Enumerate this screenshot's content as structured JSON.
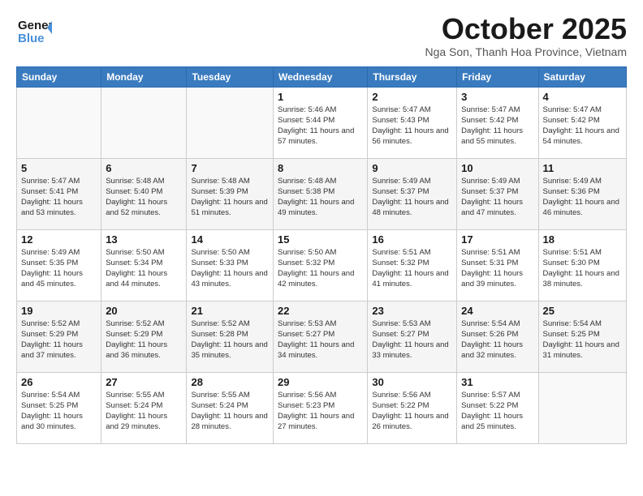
{
  "header": {
    "logo_line1": "General",
    "logo_line2": "Blue",
    "month": "October 2025",
    "location": "Nga Son, Thanh Hoa Province, Vietnam"
  },
  "weekdays": [
    "Sunday",
    "Monday",
    "Tuesday",
    "Wednesday",
    "Thursday",
    "Friday",
    "Saturday"
  ],
  "weeks": [
    [
      {
        "day": "",
        "info": ""
      },
      {
        "day": "",
        "info": ""
      },
      {
        "day": "",
        "info": ""
      },
      {
        "day": "1",
        "info": "Sunrise: 5:46 AM\nSunset: 5:44 PM\nDaylight: 11 hours and 57 minutes."
      },
      {
        "day": "2",
        "info": "Sunrise: 5:47 AM\nSunset: 5:43 PM\nDaylight: 11 hours and 56 minutes."
      },
      {
        "day": "3",
        "info": "Sunrise: 5:47 AM\nSunset: 5:42 PM\nDaylight: 11 hours and 55 minutes."
      },
      {
        "day": "4",
        "info": "Sunrise: 5:47 AM\nSunset: 5:42 PM\nDaylight: 11 hours and 54 minutes."
      }
    ],
    [
      {
        "day": "5",
        "info": "Sunrise: 5:47 AM\nSunset: 5:41 PM\nDaylight: 11 hours and 53 minutes."
      },
      {
        "day": "6",
        "info": "Sunrise: 5:48 AM\nSunset: 5:40 PM\nDaylight: 11 hours and 52 minutes."
      },
      {
        "day": "7",
        "info": "Sunrise: 5:48 AM\nSunset: 5:39 PM\nDaylight: 11 hours and 51 minutes."
      },
      {
        "day": "8",
        "info": "Sunrise: 5:48 AM\nSunset: 5:38 PM\nDaylight: 11 hours and 49 minutes."
      },
      {
        "day": "9",
        "info": "Sunrise: 5:49 AM\nSunset: 5:37 PM\nDaylight: 11 hours and 48 minutes."
      },
      {
        "day": "10",
        "info": "Sunrise: 5:49 AM\nSunset: 5:37 PM\nDaylight: 11 hours and 47 minutes."
      },
      {
        "day": "11",
        "info": "Sunrise: 5:49 AM\nSunset: 5:36 PM\nDaylight: 11 hours and 46 minutes."
      }
    ],
    [
      {
        "day": "12",
        "info": "Sunrise: 5:49 AM\nSunset: 5:35 PM\nDaylight: 11 hours and 45 minutes."
      },
      {
        "day": "13",
        "info": "Sunrise: 5:50 AM\nSunset: 5:34 PM\nDaylight: 11 hours and 44 minutes."
      },
      {
        "day": "14",
        "info": "Sunrise: 5:50 AM\nSunset: 5:33 PM\nDaylight: 11 hours and 43 minutes."
      },
      {
        "day": "15",
        "info": "Sunrise: 5:50 AM\nSunset: 5:32 PM\nDaylight: 11 hours and 42 minutes."
      },
      {
        "day": "16",
        "info": "Sunrise: 5:51 AM\nSunset: 5:32 PM\nDaylight: 11 hours and 41 minutes."
      },
      {
        "day": "17",
        "info": "Sunrise: 5:51 AM\nSunset: 5:31 PM\nDaylight: 11 hours and 39 minutes."
      },
      {
        "day": "18",
        "info": "Sunrise: 5:51 AM\nSunset: 5:30 PM\nDaylight: 11 hours and 38 minutes."
      }
    ],
    [
      {
        "day": "19",
        "info": "Sunrise: 5:52 AM\nSunset: 5:29 PM\nDaylight: 11 hours and 37 minutes."
      },
      {
        "day": "20",
        "info": "Sunrise: 5:52 AM\nSunset: 5:29 PM\nDaylight: 11 hours and 36 minutes."
      },
      {
        "day": "21",
        "info": "Sunrise: 5:52 AM\nSunset: 5:28 PM\nDaylight: 11 hours and 35 minutes."
      },
      {
        "day": "22",
        "info": "Sunrise: 5:53 AM\nSunset: 5:27 PM\nDaylight: 11 hours and 34 minutes."
      },
      {
        "day": "23",
        "info": "Sunrise: 5:53 AM\nSunset: 5:27 PM\nDaylight: 11 hours and 33 minutes."
      },
      {
        "day": "24",
        "info": "Sunrise: 5:54 AM\nSunset: 5:26 PM\nDaylight: 11 hours and 32 minutes."
      },
      {
        "day": "25",
        "info": "Sunrise: 5:54 AM\nSunset: 5:25 PM\nDaylight: 11 hours and 31 minutes."
      }
    ],
    [
      {
        "day": "26",
        "info": "Sunrise: 5:54 AM\nSunset: 5:25 PM\nDaylight: 11 hours and 30 minutes."
      },
      {
        "day": "27",
        "info": "Sunrise: 5:55 AM\nSunset: 5:24 PM\nDaylight: 11 hours and 29 minutes."
      },
      {
        "day": "28",
        "info": "Sunrise: 5:55 AM\nSunset: 5:24 PM\nDaylight: 11 hours and 28 minutes."
      },
      {
        "day": "29",
        "info": "Sunrise: 5:56 AM\nSunset: 5:23 PM\nDaylight: 11 hours and 27 minutes."
      },
      {
        "day": "30",
        "info": "Sunrise: 5:56 AM\nSunset: 5:22 PM\nDaylight: 11 hours and 26 minutes."
      },
      {
        "day": "31",
        "info": "Sunrise: 5:57 AM\nSunset: 5:22 PM\nDaylight: 11 hours and 25 minutes."
      },
      {
        "day": "",
        "info": ""
      }
    ]
  ]
}
